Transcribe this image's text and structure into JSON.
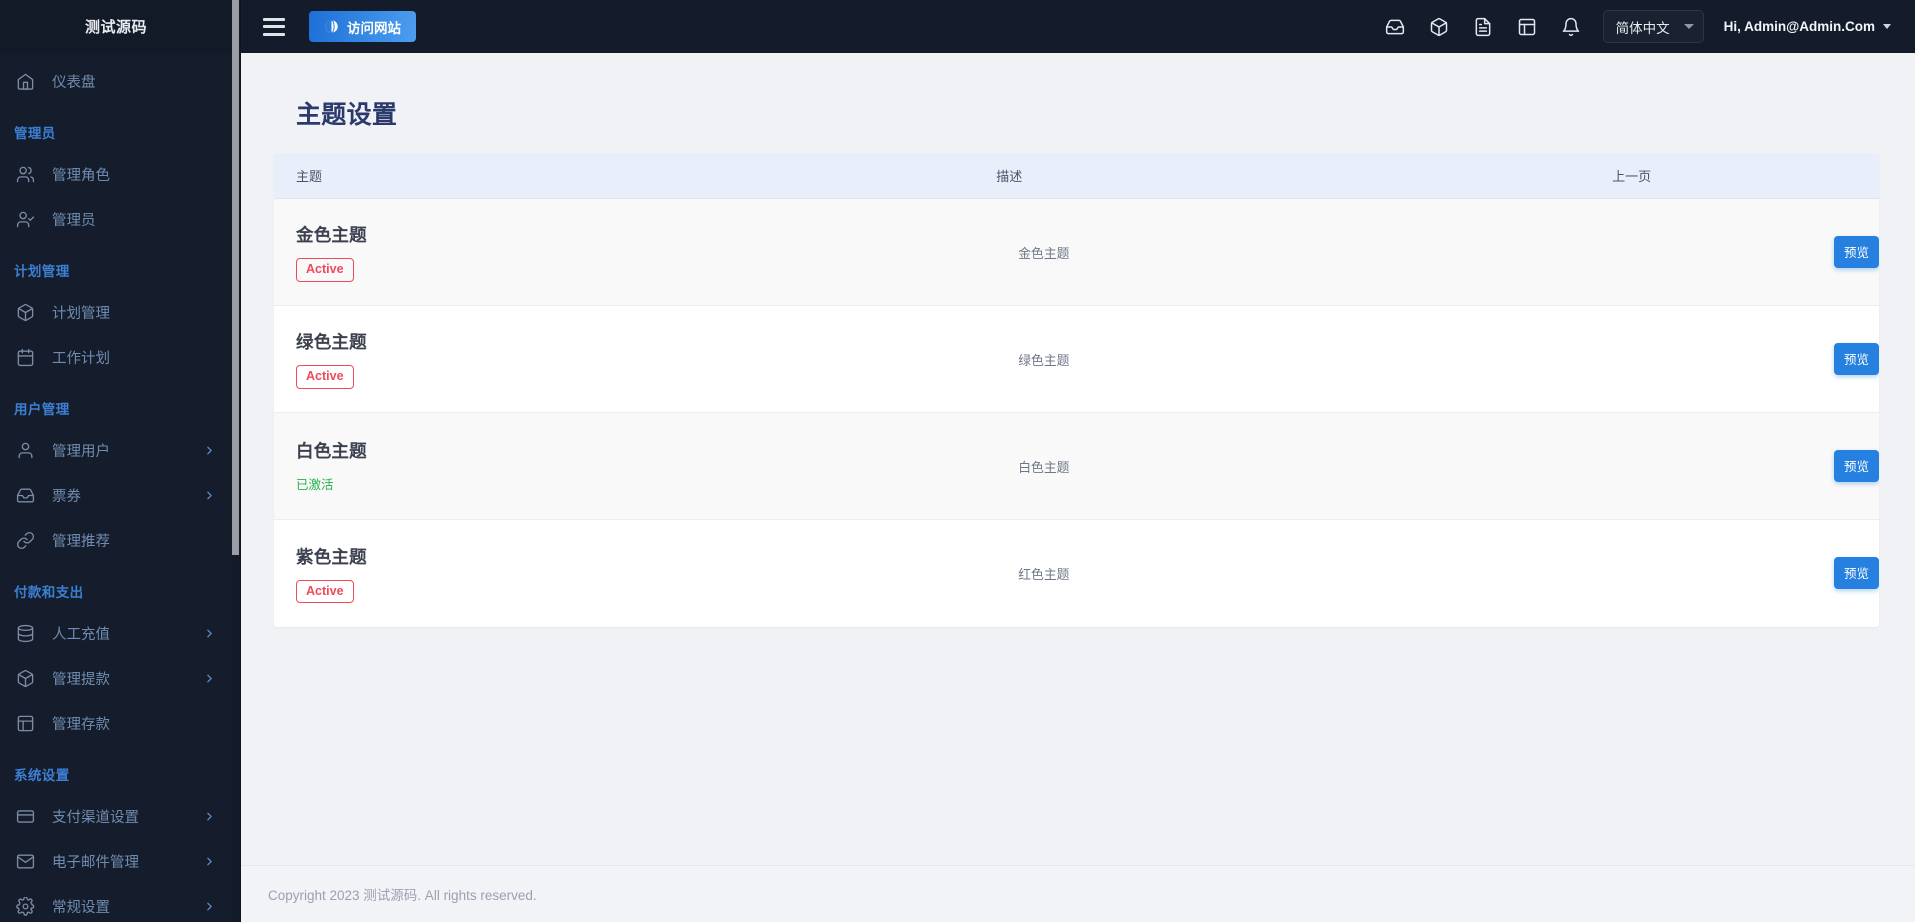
{
  "sidebar": {
    "brand": "测试源码",
    "groups": [
      {
        "title": null,
        "items": [
          {
            "label": "仪表盘",
            "icon": "home-icon",
            "expandable": false
          }
        ]
      },
      {
        "title": "管理员",
        "items": [
          {
            "label": "管理角色",
            "icon": "users-icon",
            "expandable": false
          },
          {
            "label": "管理员",
            "icon": "user-check-icon",
            "expandable": false
          }
        ]
      },
      {
        "title": "计划管理",
        "items": [
          {
            "label": "计划管理",
            "icon": "box-icon",
            "expandable": false
          },
          {
            "label": "工作计划",
            "icon": "calendar-icon",
            "expandable": false
          }
        ]
      },
      {
        "title": "用户管理",
        "items": [
          {
            "label": "管理用户",
            "icon": "user-icon",
            "expandable": true
          },
          {
            "label": "票券",
            "icon": "inbox-icon",
            "expandable": true
          },
          {
            "label": "管理推荐",
            "icon": "link-icon",
            "expandable": false
          }
        ]
      },
      {
        "title": "付款和支出",
        "items": [
          {
            "label": "人工充值",
            "icon": "database-icon",
            "expandable": true
          },
          {
            "label": "管理提款",
            "icon": "package-icon",
            "expandable": true
          },
          {
            "label": "管理存款",
            "icon": "layout-icon",
            "expandable": false
          }
        ]
      },
      {
        "title": "系统设置",
        "items": [
          {
            "label": "支付渠道设置",
            "icon": "credit-card-icon",
            "expandable": true
          },
          {
            "label": "电子邮件管理",
            "icon": "mail-icon",
            "expandable": true
          },
          {
            "label": "常规设置",
            "icon": "gear-icon",
            "expandable": true
          }
        ]
      }
    ]
  },
  "topbar": {
    "menu_toggle": "hamburger-icon",
    "visit_site_label": "访问网站",
    "icons": [
      "inbox-icon",
      "package-icon",
      "file-text-icon",
      "table-icon",
      "bell-icon"
    ],
    "language": {
      "selected": "简体中文"
    },
    "user": {
      "greeting": "Hi, Admin@Admin.Com"
    }
  },
  "page": {
    "title": "主题设置"
  },
  "table": {
    "headers": {
      "theme": "主题",
      "description": "描述",
      "action": "上一页"
    },
    "rows": [
      {
        "name": "金色主题",
        "status_label": "Active",
        "status_type": "badge",
        "description": "金色主题",
        "action_label": "预览"
      },
      {
        "name": "绿色主题",
        "status_label": "Active",
        "status_type": "badge",
        "description": "绿色主题",
        "action_label": "预览"
      },
      {
        "name": "白色主题",
        "status_label": "已激活",
        "status_type": "text-green",
        "description": "白色主题",
        "action_label": "预览"
      },
      {
        "name": "紫色主题",
        "status_label": "Active",
        "status_type": "badge",
        "description": "红色主题",
        "action_label": "预览"
      }
    ]
  },
  "footer": {
    "copyright": "Copyright 2023 测试源码. All rights reserved."
  },
  "colors": {
    "sidebar_bg": "#151d2c",
    "topbar_bg": "#141b2a",
    "accent_blue": "#2680e0",
    "group_title": "#3c7fd4",
    "badge_red": "#ef4a5b",
    "status_green": "#25b24b",
    "title_navy": "#2b3a6b",
    "table_header_bg": "#e9eefb"
  }
}
